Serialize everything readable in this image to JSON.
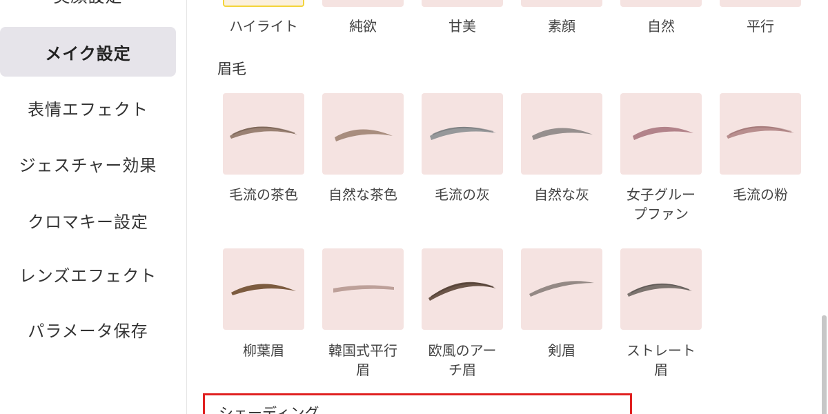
{
  "sidebar": {
    "items": [
      {
        "label": "美顔設定"
      },
      {
        "label": "メイク設定"
      },
      {
        "label": "表情エフェクト"
      },
      {
        "label": "ジェスチャー効果"
      },
      {
        "label": "クロマキー設定"
      },
      {
        "label": "レンズエフェクト"
      },
      {
        "label": "パラメータ保存"
      }
    ],
    "active": "メイク設定"
  },
  "top_row": {
    "labels": [
      "ハイライト",
      "純欲",
      "甘美",
      "素顔",
      "自然",
      "平行"
    ],
    "selected": "ハイライト"
  },
  "eyebrow_section": {
    "title": "眉毛",
    "items": [
      {
        "label": "毛流の茶色",
        "icon": "brow-brown-feather-icon",
        "color": "#8a705f"
      },
      {
        "label": "自然な茶色",
        "icon": "brow-natural-brown-icon",
        "color": "#9a7e6c"
      },
      {
        "label": "毛流の灰",
        "icon": "brow-grey-feather-icon",
        "color": "#8c8f92"
      },
      {
        "label": "自然な灰",
        "icon": "brow-natural-grey-icon",
        "color": "#85807f"
      },
      {
        "label": "女子グループファン",
        "line1": "女子グルー",
        "line2": "プファン",
        "icon": "brow-girl-group-icon",
        "color": "#a6727a"
      },
      {
        "label": "毛流の粉",
        "icon": "brow-pink-feather-icon",
        "color": "#ad7f7f"
      },
      {
        "label": "柳葉眉",
        "icon": "brow-willow-leaf-icon",
        "color": "#7c5b3f"
      },
      {
        "label": "韓国式平行眉",
        "line1": "韓国式平行",
        "line2": "眉",
        "icon": "brow-korean-straight-icon",
        "color": "#b79891"
      },
      {
        "label": "欧風のアーチ眉",
        "line1": "欧風のアー",
        "line2": "チ眉",
        "icon": "brow-euro-arch-icon",
        "color": "#6b5548"
      },
      {
        "label": "剣眉",
        "icon": "brow-sword-icon",
        "color": "#8e8480"
      },
      {
        "label": "ストレート眉",
        "line1": "ストレート",
        "line2": "眉",
        "icon": "brow-straight-icon",
        "color": "#6f6763"
      }
    ]
  },
  "shading_section": {
    "title": "シェーディング"
  }
}
